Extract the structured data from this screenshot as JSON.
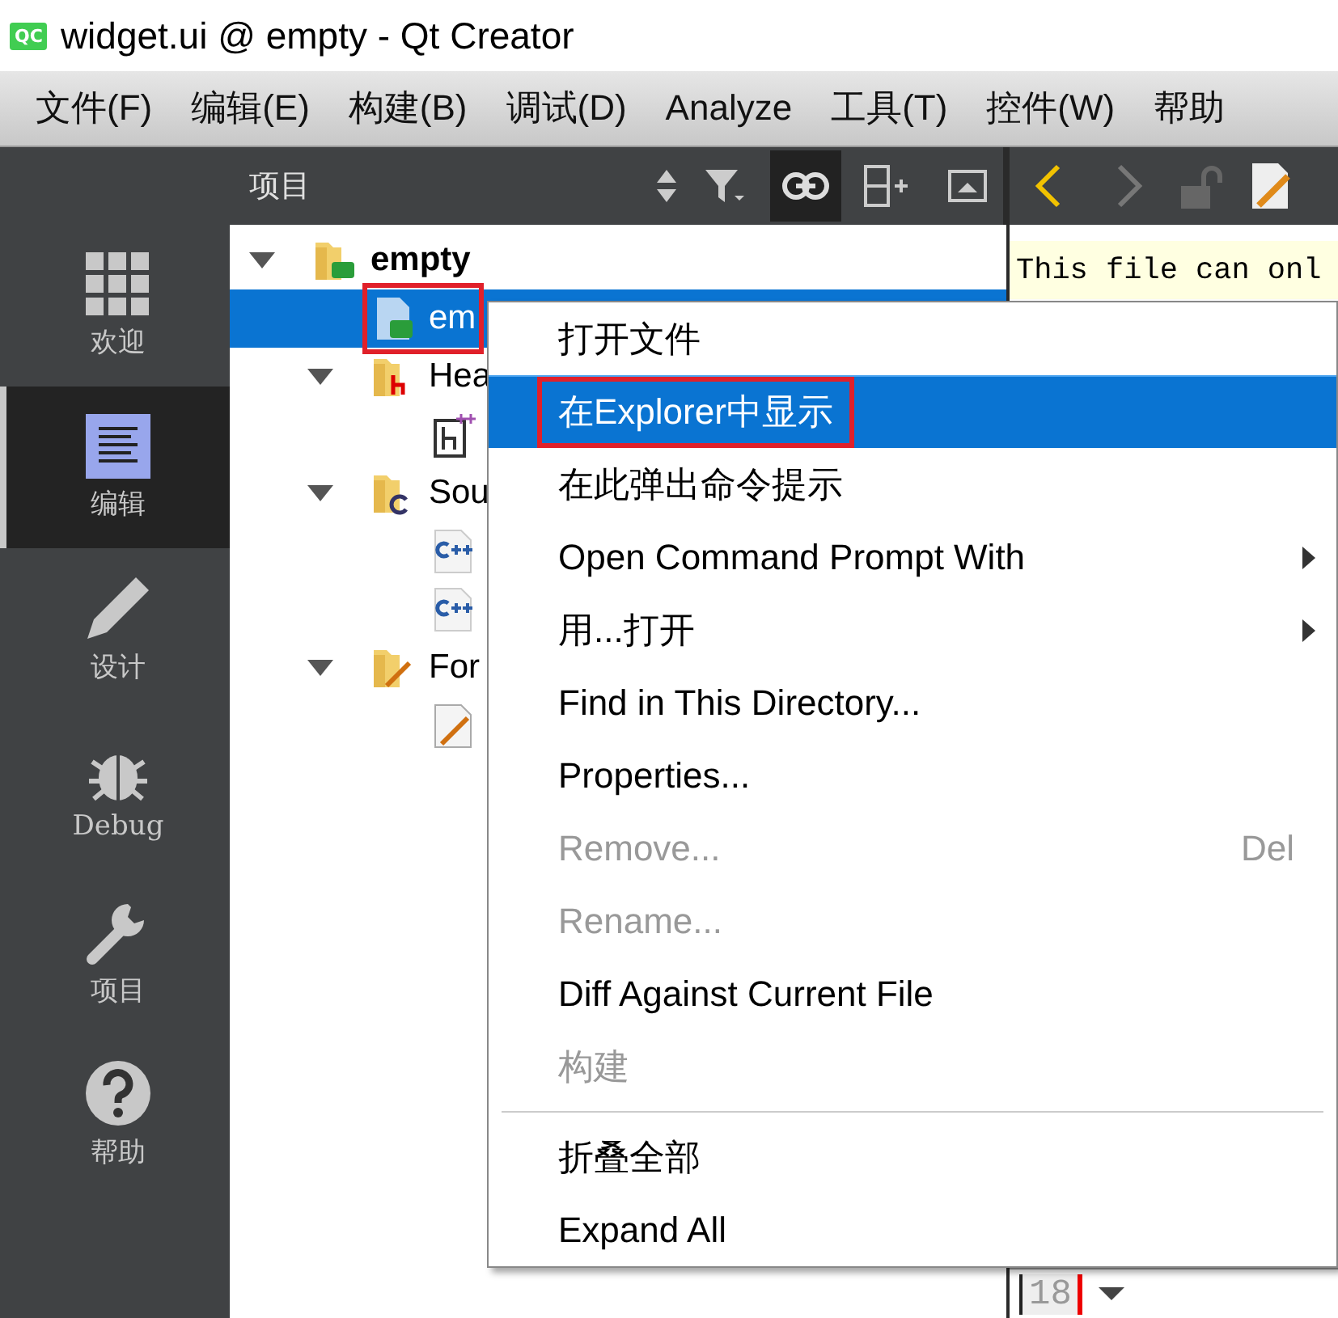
{
  "window": {
    "title": "widget.ui @ empty - Qt Creator",
    "logo": "QC"
  },
  "menu_bar": [
    "文件(F)",
    "编辑(E)",
    "构建(B)",
    "调试(D)",
    "Analyze",
    "工具(T)",
    "控件(W)",
    "帮助"
  ],
  "mode_bar": [
    {
      "label": "欢迎",
      "selected": false
    },
    {
      "label": "编辑",
      "selected": true
    },
    {
      "label": "设计",
      "selected": false
    },
    {
      "label": "Debug",
      "selected": false
    },
    {
      "label": "项目",
      "selected": false
    },
    {
      "label": "帮助",
      "selected": false
    }
  ],
  "project_pane": {
    "title": "项目",
    "link_selected": true,
    "tree": [
      {
        "label": "empty",
        "bold": true,
        "expanded": true,
        "selected": false,
        "outlined": false,
        "children": [
          {
            "label": "em",
            "selected": true,
            "outlined": true
          },
          {
            "label": "Hea",
            "expanded": true,
            "selected": false,
            "outlined": false,
            "children": [
              {
                "selected": false,
                "outlined": false
              }
            ]
          },
          {
            "label": "Sou",
            "expanded": true,
            "selected": false,
            "outlined": false,
            "children": [
              {
                "selected": false,
                "outlined": false
              },
              {
                "selected": false,
                "outlined": false
              }
            ]
          },
          {
            "label": "For",
            "expanded": true,
            "selected": false,
            "outlined": false,
            "children": [
              {
                "selected": false,
                "outlined": false
              }
            ]
          }
        ]
      }
    ]
  },
  "editor": {
    "info_bar": "This file can onl",
    "line_number": "18"
  },
  "context_menu": [
    {
      "kind": "item",
      "label": "打开文件",
      "selected": false,
      "disabled": false,
      "outlined": false
    },
    {
      "kind": "item",
      "label": "在Explorer中显示",
      "selected": true,
      "disabled": false,
      "outlined": true
    },
    {
      "kind": "item",
      "label": "在此弹出命令提示",
      "selected": false,
      "disabled": false,
      "outlined": false
    },
    {
      "kind": "submenu",
      "label": "Open Command Prompt With",
      "selected": false,
      "disabled": false,
      "outlined": false
    },
    {
      "kind": "submenu",
      "label": "用...打开",
      "selected": false,
      "disabled": false,
      "outlined": false
    },
    {
      "kind": "item",
      "label": "Find in This Directory...",
      "selected": false,
      "disabled": false,
      "outlined": false
    },
    {
      "kind": "item",
      "label": "Properties...",
      "selected": false,
      "disabled": false,
      "outlined": false
    },
    {
      "kind": "item",
      "label": "Remove...",
      "shortcut": "Del",
      "selected": false,
      "disabled": true,
      "outlined": false
    },
    {
      "kind": "item",
      "label": "Rename...",
      "selected": false,
      "disabled": true,
      "outlined": false
    },
    {
      "kind": "item",
      "label": "Diff Against Current File",
      "selected": false,
      "disabled": false,
      "outlined": false
    },
    {
      "kind": "item",
      "label": "构建",
      "selected": false,
      "disabled": true,
      "outlined": false
    },
    {
      "kind": "separator"
    },
    {
      "kind": "item",
      "label": "折叠全部",
      "selected": false,
      "disabled": false,
      "outlined": false
    },
    {
      "kind": "item",
      "label": "Expand All",
      "selected": false,
      "disabled": false,
      "outlined": false
    }
  ]
}
